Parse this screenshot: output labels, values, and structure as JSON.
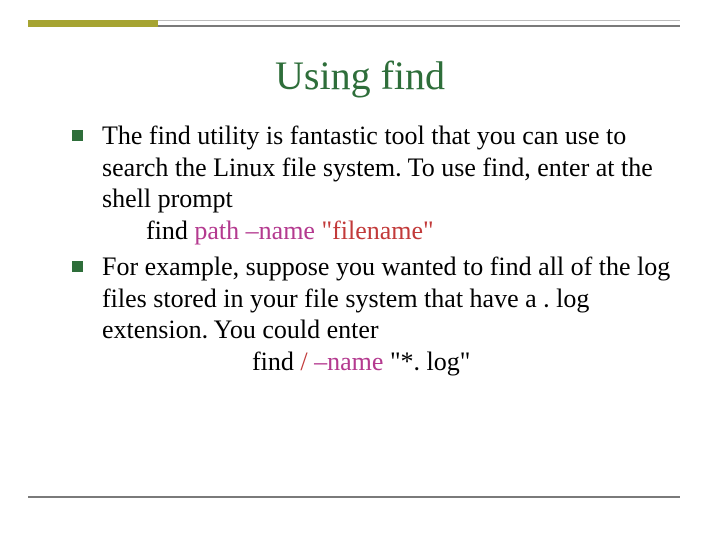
{
  "title": "Using find",
  "items": [
    {
      "text": "The find utility is fantastic tool that you can use to search the Linux file system. To use find, enter at the shell prompt",
      "command": {
        "indentClass": "indent1",
        "parts": [
          {
            "text": "find  ",
            "cls": ""
          },
          {
            "text": "path",
            "cls": "cmd-path"
          },
          {
            "text": " ",
            "cls": ""
          },
          {
            "text": "–name",
            "cls": "cmd-opt"
          },
          {
            "text": "  ",
            "cls": ""
          },
          {
            "text": "\"filename\"",
            "cls": "cmd-arg"
          }
        ]
      }
    },
    {
      "text": "For example, suppose you wanted to find all of the log files stored in your file system that have  a  . log  extension. You could enter",
      "command": {
        "indentClass": "indent2",
        "parts": [
          {
            "text": "find  ",
            "cls": ""
          },
          {
            "text": "/",
            "cls": "cmd-root"
          },
          {
            "text": " ",
            "cls": ""
          },
          {
            "text": "–name",
            "cls": "cmd-opt"
          },
          {
            "text": " \"*. log\"",
            "cls": ""
          }
        ]
      }
    }
  ]
}
